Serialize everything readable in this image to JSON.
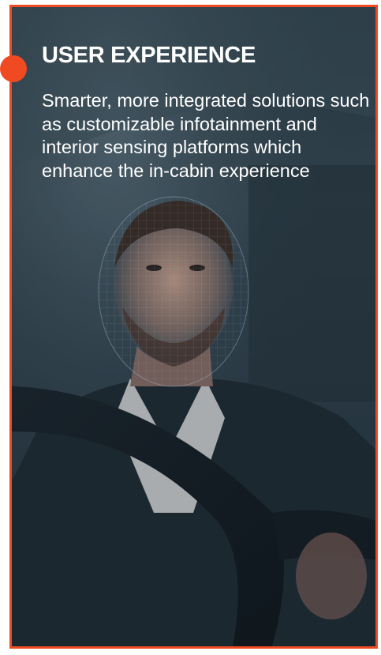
{
  "card": {
    "title": "USER EXPERIENCE",
    "description": "Smarter, more integrated solutions such as customizable infotainment and interior sensing platforms which enhance the in-cabin experience"
  },
  "colors": {
    "accent": "#f04a22",
    "text": "#ffffff"
  },
  "image": {
    "subject": "driver-with-face-scan-grid"
  }
}
